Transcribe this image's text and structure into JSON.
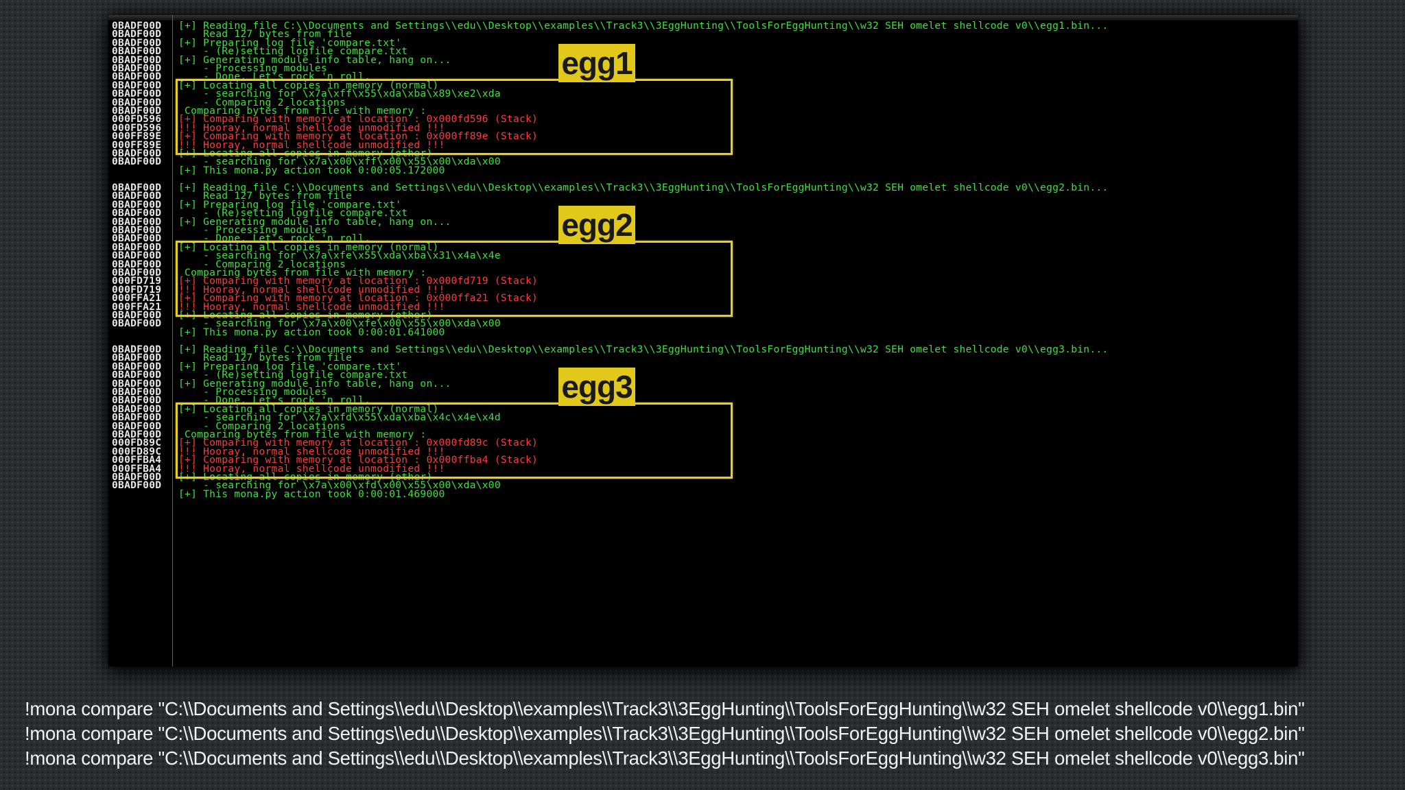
{
  "terminal": {
    "blocks": [
      {
        "label": "egg1",
        "lines": [
          {
            "addr": "0BADF00D",
            "text": "[+] Reading file C:\\\\Documents and Settings\\\\edu\\\\Desktop\\\\examples\\\\Track3\\\\3EggHunting\\\\ToolsForEggHunting\\\\w32 SEH omelet shellcode v0\\\\egg1.bin...",
            "color": "green"
          },
          {
            "addr": "0BADF00D",
            "text": "    Read 127 bytes from file",
            "color": "green"
          },
          {
            "addr": "0BADF00D",
            "text": "[+] Preparing log file 'compare.txt'",
            "color": "green"
          },
          {
            "addr": "0BADF00D",
            "text": "    - (Re)setting logfile compare.txt",
            "color": "green"
          },
          {
            "addr": "0BADF00D",
            "text": "[+] Generating module info table, hang on...",
            "color": "green"
          },
          {
            "addr": "0BADF00D",
            "text": "    - Processing modules",
            "color": "green"
          },
          {
            "addr": "0BADF00D",
            "text": "    - Done. Let's rock 'n roll.",
            "color": "green"
          },
          {
            "addr": "0BADF00D",
            "text": "[+] Locating all copies in memory (normal)",
            "color": "green"
          },
          {
            "addr": "0BADF00D",
            "text": "    - searching for \\x7a\\xff\\x55\\xda\\xba\\x89\\xe2\\xda",
            "color": "green"
          },
          {
            "addr": "0BADF00D",
            "text": "    - Comparing 2 locations",
            "color": "green"
          },
          {
            "addr": "0BADF00D",
            "text": " Comparing bytes from file with memory :",
            "color": "green"
          },
          {
            "addr": "000FD596",
            "text": "[+] Comparing with memory at location : 0x000fd596 (Stack)",
            "color": "red"
          },
          {
            "addr": "000FD596",
            "text": "!!! Hooray, normal shellcode unmodified !!!",
            "color": "red"
          },
          {
            "addr": "000FF89E",
            "text": "[+] Comparing with memory at location : 0x000ff89e (Stack)",
            "color": "red"
          },
          {
            "addr": "000FF89E",
            "text": "!!! Hooray, normal shellcode unmodified !!!",
            "color": "red"
          },
          {
            "addr": "0BADF00D",
            "text": "[+] Locating all copies in memory (other)",
            "color": "green"
          },
          {
            "addr": "0BADF00D",
            "text": "    - searching for \\x7a\\x00\\xff\\x00\\x55\\x00\\xda\\x00",
            "color": "green"
          },
          {
            "addr": "",
            "text": "[+] This mona.py action took 0:00:05.172000",
            "color": "green"
          }
        ]
      },
      {
        "label": "egg2",
        "lines": [
          {
            "addr": "0BADF00D",
            "text": "[+] Reading file C:\\\\Documents and Settings\\\\edu\\\\Desktop\\\\examples\\\\Track3\\\\3EggHunting\\\\ToolsForEggHunting\\\\w32 SEH omelet shellcode v0\\\\egg2.bin...",
            "color": "green"
          },
          {
            "addr": "0BADF00D",
            "text": "    Read 127 bytes from file",
            "color": "green"
          },
          {
            "addr": "0BADF00D",
            "text": "[+] Preparing log file 'compare.txt'",
            "color": "green"
          },
          {
            "addr": "0BADF00D",
            "text": "    - (Re)setting logfile compare.txt",
            "color": "green"
          },
          {
            "addr": "0BADF00D",
            "text": "[+] Generating module info table, hang on...",
            "color": "green"
          },
          {
            "addr": "0BADF00D",
            "text": "    - Processing modules",
            "color": "green"
          },
          {
            "addr": "0BADF00D",
            "text": "    - Done. Let's rock 'n roll.",
            "color": "green"
          },
          {
            "addr": "0BADF00D",
            "text": "[+] Locating all copies in memory (normal)",
            "color": "green"
          },
          {
            "addr": "0BADF00D",
            "text": "    - searching for \\x7a\\xfe\\x55\\xda\\xba\\x31\\x4a\\x4e",
            "color": "green"
          },
          {
            "addr": "0BADF00D",
            "text": "    - Comparing 2 locations",
            "color": "green"
          },
          {
            "addr": "0BADF00D",
            "text": " Comparing bytes from file with memory :",
            "color": "green"
          },
          {
            "addr": "000FD719",
            "text": "[+] Comparing with memory at location : 0x000fd719 (Stack)",
            "color": "red"
          },
          {
            "addr": "000FD719",
            "text": "!!! Hooray, normal shellcode unmodified !!!",
            "color": "red"
          },
          {
            "addr": "000FFA21",
            "text": "[+] Comparing with memory at location : 0x000ffa21 (Stack)",
            "color": "red"
          },
          {
            "addr": "000FFA21",
            "text": "!!! Hooray, normal shellcode unmodified !!!",
            "color": "red"
          },
          {
            "addr": "0BADF00D",
            "text": "[+] Locating all copies in memory (other)",
            "color": "green"
          },
          {
            "addr": "0BADF00D",
            "text": "    - searching for \\x7a\\x00\\xfe\\x00\\x55\\x00\\xda\\x00",
            "color": "green"
          },
          {
            "addr": "",
            "text": "[+] This mona.py action took 0:00:01.641000",
            "color": "green"
          }
        ]
      },
      {
        "label": "egg3",
        "lines": [
          {
            "addr": "0BADF00D",
            "text": "[+] Reading file C:\\\\Documents and Settings\\\\edu\\\\Desktop\\\\examples\\\\Track3\\\\3EggHunting\\\\ToolsForEggHunting\\\\w32 SEH omelet shellcode v0\\\\egg3.bin...",
            "color": "green"
          },
          {
            "addr": "0BADF00D",
            "text": "    Read 127 bytes from file",
            "color": "green"
          },
          {
            "addr": "0BADF00D",
            "text": "[+] Preparing log file 'compare.txt'",
            "color": "green"
          },
          {
            "addr": "0BADF00D",
            "text": "    - (Re)setting logfile compare.txt",
            "color": "green"
          },
          {
            "addr": "0BADF00D",
            "text": "[+] Generating module info table, hang on...",
            "color": "green"
          },
          {
            "addr": "0BADF00D",
            "text": "    - Processing modules",
            "color": "green"
          },
          {
            "addr": "0BADF00D",
            "text": "    - Done. Let's rock 'n roll.",
            "color": "green"
          },
          {
            "addr": "0BADF00D",
            "text": "[+] Locating all copies in memory (normal)",
            "color": "green"
          },
          {
            "addr": "0BADF00D",
            "text": "    - searching for \\x7a\\xfd\\x55\\xda\\xba\\x4c\\x4e\\x4d",
            "color": "green"
          },
          {
            "addr": "0BADF00D",
            "text": "    - Comparing 2 locations",
            "color": "green"
          },
          {
            "addr": "0BADF00D",
            "text": " Comparing bytes from file with memory :",
            "color": "green"
          },
          {
            "addr": "000FD89C",
            "text": "[+] Comparing with memory at location : 0x000fd89c (Stack)",
            "color": "red"
          },
          {
            "addr": "000FD89C",
            "text": "!!! Hooray, normal shellcode unmodified !!!",
            "color": "red"
          },
          {
            "addr": "000FFBA4",
            "text": "[+] Comparing with memory at location : 0x000ffba4 (Stack)",
            "color": "red"
          },
          {
            "addr": "000FFBA4",
            "text": "!!! Hooray, normal shellcode unmodified !!!",
            "color": "red"
          },
          {
            "addr": "0BADF00D",
            "text": "[+] Locating all copies in memory (other)",
            "color": "green"
          },
          {
            "addr": "0BADF00D",
            "text": "    - searching for \\x7a\\x00\\xfd\\x00\\x55\\x00\\xda\\x00",
            "color": "green"
          },
          {
            "addr": "",
            "text": "[+] This mona.py action took 0:00:01.469000",
            "color": "green"
          }
        ]
      }
    ]
  },
  "captions": [
    "!mona compare \"C:\\\\Documents and Settings\\\\edu\\\\Desktop\\\\examples\\\\Track3\\\\3EggHunting\\\\ToolsForEggHunting\\\\w32 SEH omelet shellcode v0\\\\egg1.bin\"",
    "!mona compare \"C:\\\\Documents and Settings\\\\edu\\\\Desktop\\\\examples\\\\Track3\\\\3EggHunting\\\\ToolsForEggHunting\\\\w32 SEH omelet shellcode v0\\\\egg2.bin\"",
    "!mona compare \"C:\\\\Documents and Settings\\\\edu\\\\Desktop\\\\examples\\\\Track3\\\\3EggHunting\\\\ToolsForEggHunting\\\\w32 SEH omelet shellcode v0\\\\egg3.bin\""
  ],
  "colors": {
    "terminal_bg": "#000000",
    "log_green": "#3fe03f",
    "log_red": "#ff3b3b",
    "address_white": "#e8e8e8",
    "highlight_yellow": "#e3c81c"
  }
}
